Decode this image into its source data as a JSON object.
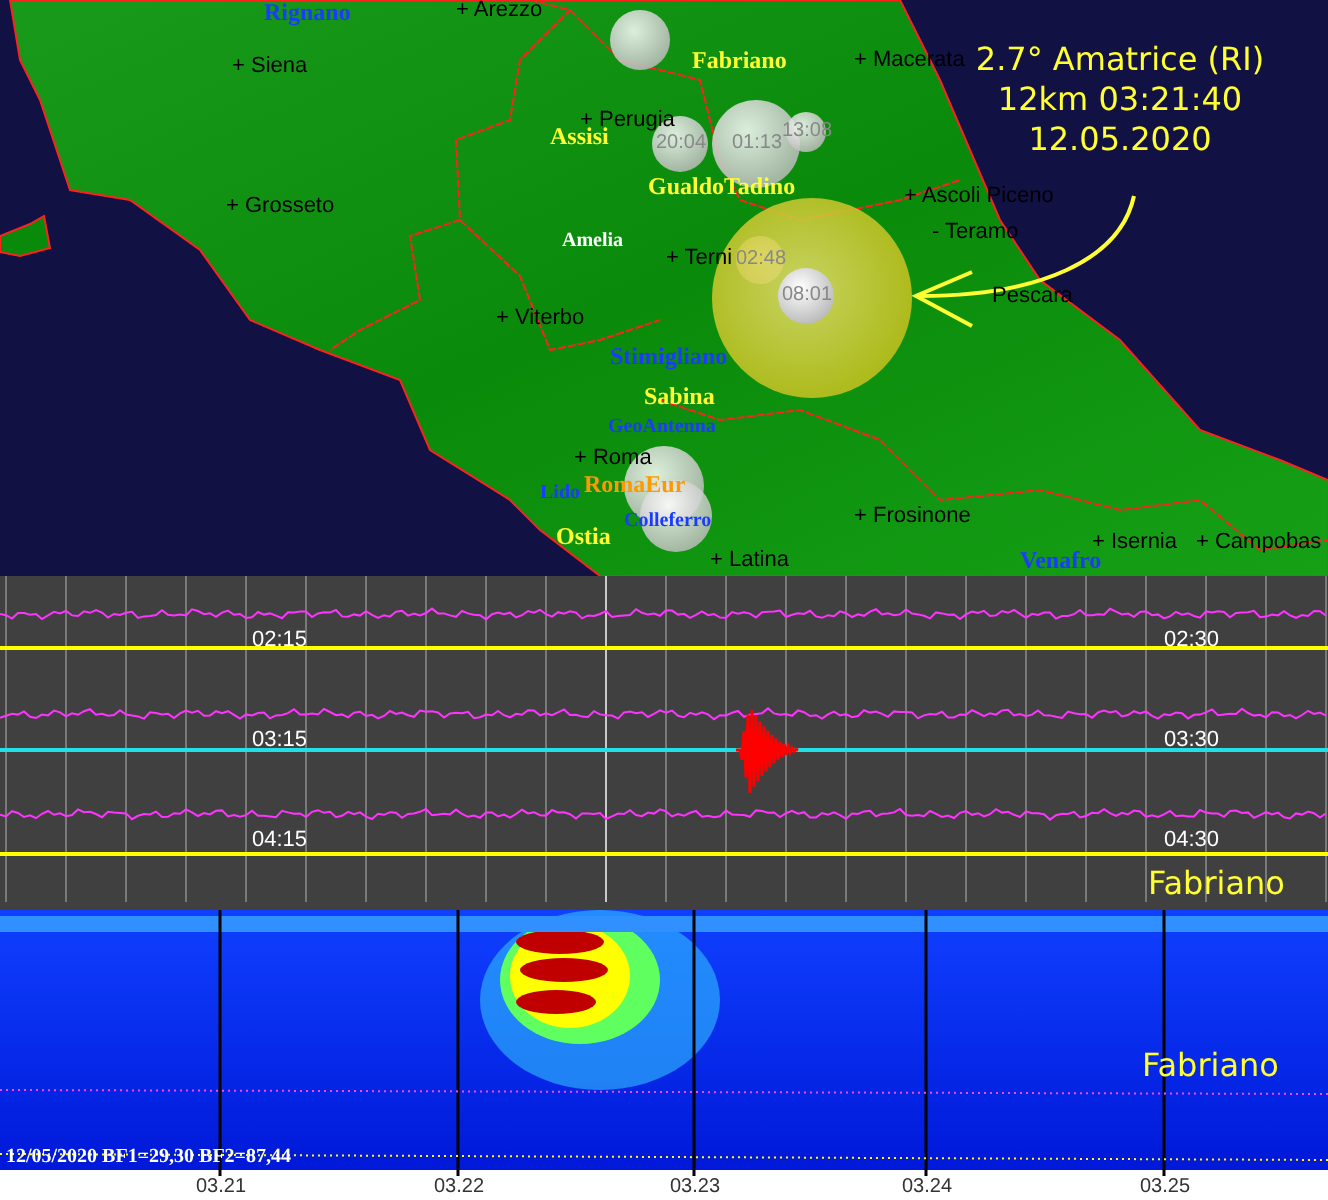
{
  "map": {
    "cities": [
      {
        "label": "+ Arezzo"
      },
      {
        "label": "+ Siena"
      },
      {
        "label": "+ Grosseto"
      },
      {
        "label": "+ Perugia"
      },
      {
        "label": "+ Viterbo"
      },
      {
        "label": "+ Terni"
      },
      {
        "label": "+ Roma"
      },
      {
        "label": "+ Macerata"
      },
      {
        "label": "+ Ascoli Piceno"
      },
      {
        "label": "- Teramo"
      },
      {
        "label": "Pescara"
      },
      {
        "label": "+ Frosinone"
      },
      {
        "label": "+ Latina"
      },
      {
        "label": "+ Isernia"
      },
      {
        "label": "+ Campobas"
      }
    ],
    "stations": [
      {
        "label": "Rignano",
        "color": "#1a3cff"
      },
      {
        "label": "Fabriano",
        "color": "#ffff33"
      },
      {
        "label": "Assisi",
        "color": "#ffff33"
      },
      {
        "label": "GualdoTadino",
        "color": "#ffff33"
      },
      {
        "label": "Amelia",
        "color": "#ffffff"
      },
      {
        "label": "Stimigliano",
        "color": "#1a3cff"
      },
      {
        "label": "Sabina",
        "color": "#ffff33"
      },
      {
        "label": "GeoAntenna",
        "color": "#1a3cff"
      },
      {
        "label": "RomaEur",
        "color": "#ff9900"
      },
      {
        "label": "Lido",
        "color": "#1a3cff"
      },
      {
        "label": "Colleferro",
        "color": "#1a3cff"
      },
      {
        "label": "Ostia",
        "color": "#ffff33"
      },
      {
        "label": "Venafro",
        "color": "#1a3cff"
      }
    ],
    "events": [
      {
        "time": "20:04",
        "kind": "past"
      },
      {
        "time": "01:13",
        "kind": "past"
      },
      {
        "time": "13:08",
        "kind": "past"
      },
      {
        "time": "02:48",
        "kind": "past"
      },
      {
        "time": "08:01",
        "kind": "latest"
      }
    ],
    "annotation": [
      "2.7° Amatrice (RI)",
      "12km 03:21:40",
      "12.05.2020"
    ]
  },
  "seismogram": {
    "rows": [
      {
        "start": "02:15",
        "end": "02:30",
        "kind": "quiet"
      },
      {
        "start": "03:15",
        "end": "03:30",
        "kind": "event"
      },
      {
        "start": "04:15",
        "end": "04:30",
        "kind": "quiet"
      }
    ],
    "station": "Fabriano"
  },
  "spectrogram": {
    "station": "Fabriano",
    "caption": "12/05/2020 BF1=29,30 BF2=87,44",
    "ticks": [
      "03.21",
      "03.22",
      "03.23",
      "03.24",
      "03.25"
    ]
  }
}
